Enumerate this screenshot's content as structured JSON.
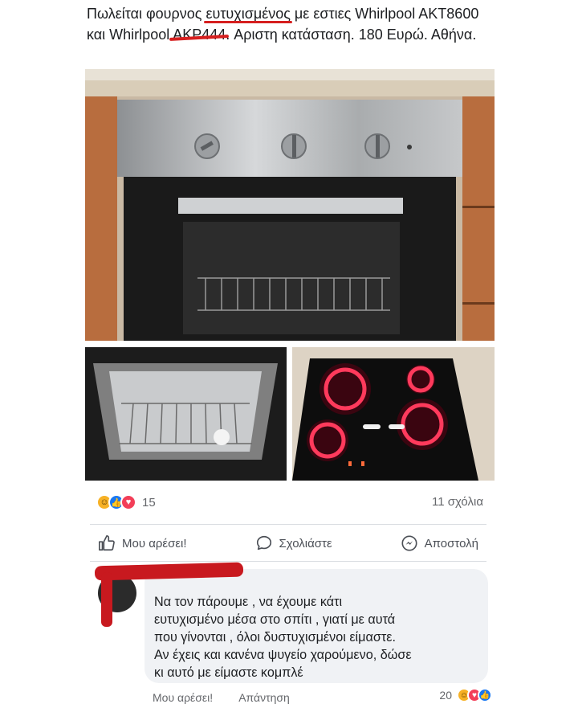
{
  "post": {
    "text_before": "Πωλείται φουρνος ",
    "text_highlight": "ευτυχισμένος",
    "text_middle": " με εστιες Whirlpool AKT8600 και Whirlpool ",
    "text_struck": "AKP444",
    "text_after": ". Αριστη κατάσταση. 180 Ευρώ. Αθήνα."
  },
  "stats": {
    "reaction_count": "15",
    "comments_count": "11 σχόλια"
  },
  "actions": {
    "like": "Μου αρέσει!",
    "comment": "Σχολιάστε",
    "share": "Αποστολή"
  },
  "comment": {
    "text": "Να τον πάρουμε , να έχουμε κάτι\nευτυχισμένο μέσα στο σπίτι , γιατί με αυτά\nπου γίνονται , όλοι δυστυχισμένοι είμαστε.\nΑν έχεις και κανένα ψυγείο χαρούμενο, δώσε\nκι αυτό με είμαστε κομπλέ",
    "like": "Μου αρέσει!",
    "reply": "Απάντηση",
    "reaction_count": "20"
  },
  "colors": {
    "accent": "#1877f2",
    "highlight_red": "#d61f1f",
    "bubble_bg": "#f0f2f5"
  }
}
